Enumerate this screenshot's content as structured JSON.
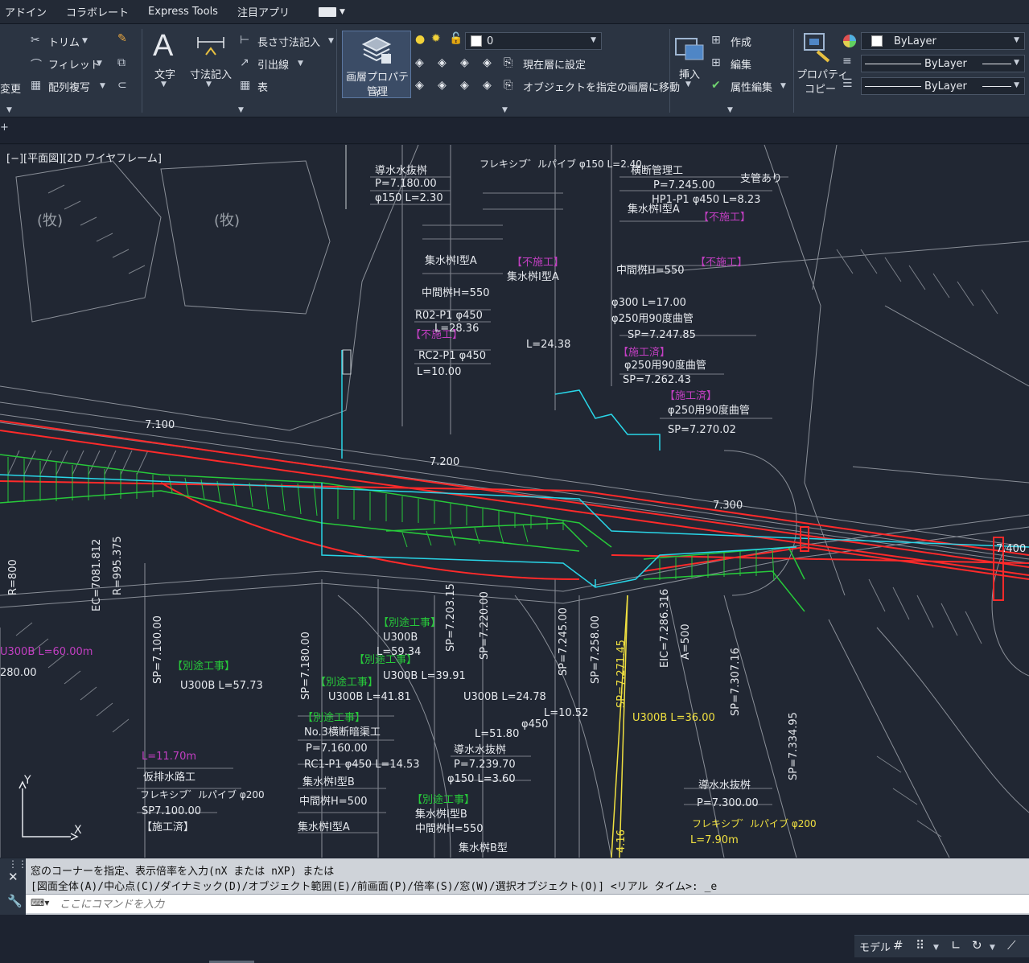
{
  "menu": {
    "items": [
      "アドイン",
      "コラボレート",
      "Express Tools",
      "注目アプリ"
    ]
  },
  "ribbon": {
    "modify": {
      "trim": "トリム",
      "fillet": "フィレット",
      "array": "配列複写",
      "change": "変更"
    },
    "annotation": {
      "text": "文字",
      "dimension": "寸法記入",
      "linear_dim": "長さ寸法記入",
      "leader": "引出線",
      "table": "表"
    },
    "layers": {
      "manager_line1": "画層プロパティ",
      "manager_line2": "管理",
      "current_layer": "0",
      "set_current": "現在層に設定",
      "match_layer": "オブジェクトを指定の画層に移動"
    },
    "block": {
      "insert": "挿入",
      "create": "作成",
      "edit": "編集",
      "attr_edit": "属性編集"
    },
    "properties": {
      "copy_line1": "プロパティ",
      "copy_line2": "コピー",
      "color": "ByLayer",
      "linetype": "ByLayer",
      "lineweight": "ByLayer"
    }
  },
  "viewport": {
    "label": "[−][平面図][2D ワイヤフレーム]"
  },
  "drawing": {
    "stations": [
      "7.100",
      "7.200",
      "7.300",
      "7.400"
    ],
    "texts": [
      "導水水抜桝",
      "P=7.180.00",
      "φ150 L=2.30",
      "フレキシブ゛ルパイブ φ150 L=2.40",
      "支管あり",
      "横断管理工",
      "P=7.245.00",
      "HP1-P1 φ450 L=8.23",
      "【不施工】",
      "集水桝Ⅰ型A",
      "中間桝H=550",
      "R02-P1 φ450",
      "L=28.36",
      "RC2-P1 φ450",
      "L=10.00",
      "L=24.38",
      "φ300 L=17.00",
      "φ250用90度曲管",
      "SP=7.247.85",
      "【施工済】",
      "SP=7.262.43",
      "SP=7.270.02",
      "(牧)",
      "R=800",
      "EC=7081.812",
      "R=995.375",
      "SP=7.100.00",
      "U300B L=57.73",
      "【別途工事】",
      "U300B",
      "L=59.34",
      "SP=7.180.00",
      "SP=7.203.15",
      "SP=7.220.00",
      "SP=7.245.00",
      "SP=7.258.00",
      "SP=7.271.45",
      "U300B L=36.00",
      "EIC=7.286.316",
      "A=500",
      "SP=7.307.16",
      "SP=7.334.95",
      "導水水抜桝",
      "P=7.300.00",
      "フレキシブ゛ルパイブ φ200",
      "L=7.90m",
      "U300B L=41.81",
      "U300B L=39.91",
      "U300B L=24.78",
      "L=10.52",
      "φ450",
      "L=51.80",
      "No.3横断暗渠工",
      "P=7.160.00",
      "RC1-P1 φ450 L=14.53",
      "集水桝Ⅰ型B",
      "中間桝H=500",
      "P=7.239.70",
      "φ150 L=3.60",
      "中間桝H=550",
      "集水桝B型",
      "仮排水路工",
      "L=11.70m",
      "SP7.100.00",
      "【施工済】",
      "U300B L=60.00m",
      "280.00",
      "4.16"
    ]
  },
  "command": {
    "line1": "窓のコーナーを指定、表示倍率を入力(nX または nXP) または",
    "line2": "[図面全体(A)/中心点(C)/ダイナミック(D)/オブジェクト範囲(E)/前画面(P)/倍率(S)/窓(W)/選択オブジェクト(O)] <リアル タイム>: _e",
    "placeholder": "ここにコマンドを入力"
  },
  "status": {
    "model": "モデル"
  },
  "colors": {
    "ribbon_bg": "#2b3442",
    "canvas_bg": "#212733",
    "red": "#ff2a2a",
    "green": "#27c93a",
    "cyan": "#29d6e8",
    "magenta": "#c23fc2",
    "yellow": "#f0e040"
  }
}
